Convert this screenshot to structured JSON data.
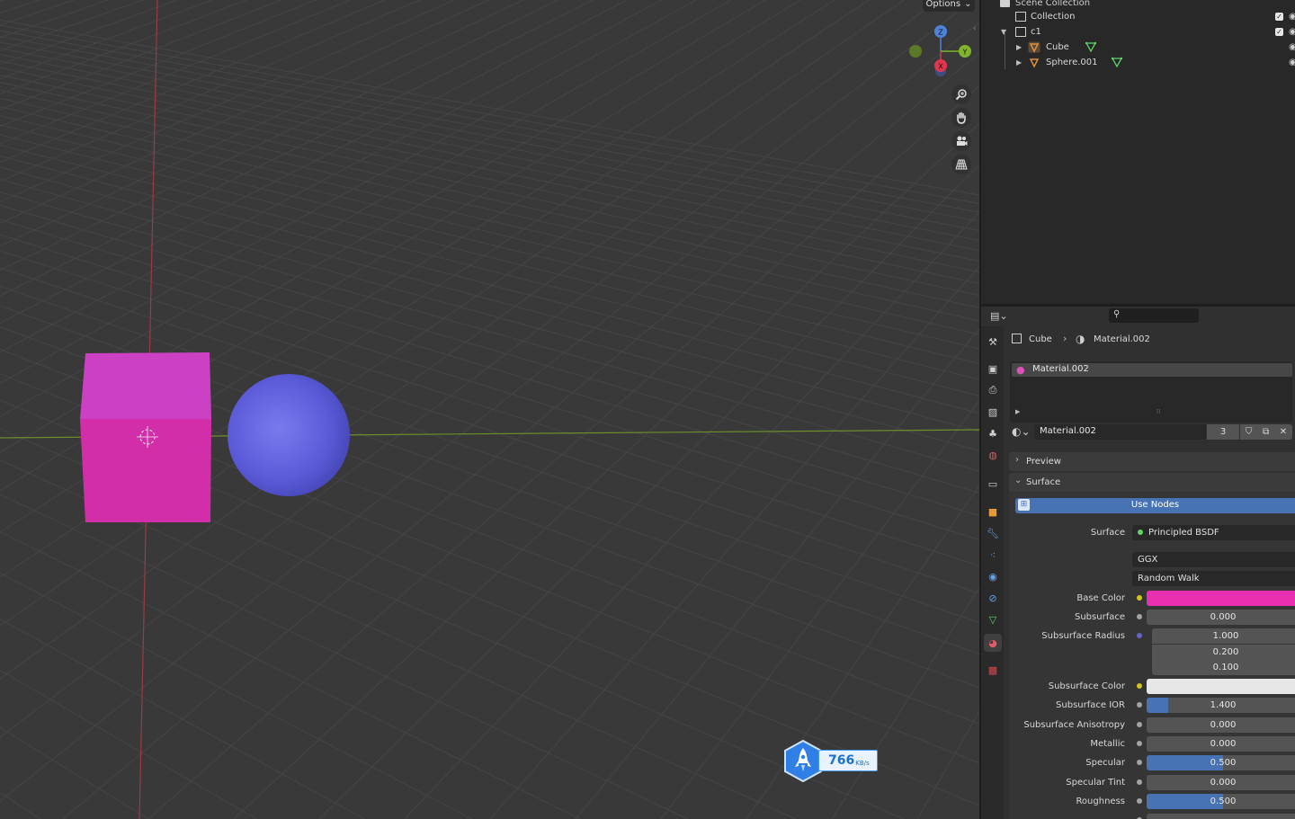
{
  "viewport": {
    "options_label": "Options",
    "gizmo_axes": {
      "z": "Z",
      "y": "Y",
      "x": "X"
    },
    "nav_tools": [
      "zoom-icon",
      "hand-pan-icon",
      "camera-icon",
      "grid-perspective-icon"
    ],
    "speed_widget": {
      "value": "766",
      "unit": "KB/s"
    }
  },
  "outliner": {
    "scene_collection": "Scene Collection",
    "rows": [
      {
        "label": "Collection",
        "icon": "collection-icon",
        "checked": true
      },
      {
        "label": "c1",
        "icon": "collection-icon",
        "checked": true
      },
      {
        "label": "Cube",
        "icon": "mesh-object-icon"
      },
      {
        "label": "Sphere.001",
        "icon": "mesh-object-icon"
      }
    ]
  },
  "properties": {
    "breadcrumb": {
      "object": "Cube",
      "material": "Material.002"
    },
    "material_slots": [
      "Material.002"
    ],
    "datablock": {
      "name": "Material.002",
      "users": "3"
    },
    "panels": {
      "preview": "Preview",
      "surface": "Surface"
    },
    "use_nodes_label": "Use Nodes",
    "surface": {
      "label": "Surface",
      "value": "Principled BSDF"
    },
    "distribution": "GGX",
    "subsurface_method": "Random Walk",
    "params": [
      {
        "label": "Base Color",
        "type": "color",
        "color": "#e830b0",
        "dot": "#d4c31c"
      },
      {
        "label": "Subsurface",
        "value": "0.000",
        "fill": 0,
        "dot": "#a3a3a3"
      },
      {
        "label": "Subsurface Radius",
        "vector": [
          "1.000",
          "0.200",
          "0.100"
        ],
        "dot": "#6363c7"
      },
      {
        "label": "Subsurface Color",
        "type": "color",
        "color": "#e6e6e6",
        "dot": "#d4c31c"
      },
      {
        "label": "Subsurface IOR",
        "value": "1.400",
        "fill": 0.14,
        "dot": "#a3a3a3"
      },
      {
        "label": "Subsurface Anisotropy",
        "value": "0.000",
        "fill": 0,
        "dot": "#a3a3a3"
      },
      {
        "label": "Metallic",
        "value": "0.000",
        "fill": 0,
        "dot": "#a3a3a3"
      },
      {
        "label": "Specular",
        "value": "0.500",
        "fill": 0.5,
        "dot": "#a3a3a3"
      },
      {
        "label": "Specular Tint",
        "value": "0.000",
        "fill": 0,
        "dot": "#a3a3a3"
      },
      {
        "label": "Roughness",
        "value": "0.500",
        "fill": 0.5,
        "dot": "#a3a3a3"
      }
    ]
  },
  "colors": {
    "cube": "#d22fb4",
    "sphere": "#5b5bd6",
    "accent_blue": "#4772b3",
    "mesh_data_green": "#5fd16a"
  }
}
